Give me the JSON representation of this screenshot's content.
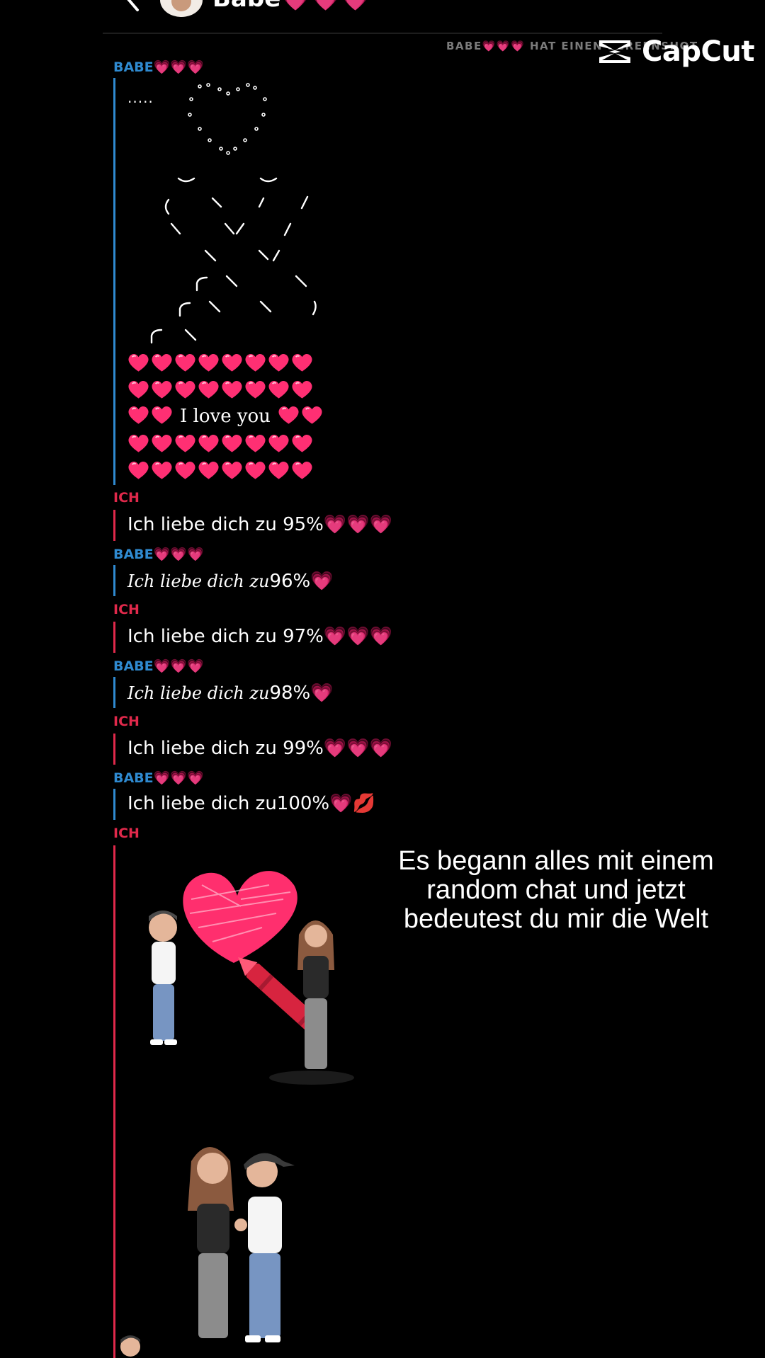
{
  "header": {
    "contact_name": "Babe",
    "contact_hearts": "💗💗💗"
  },
  "system_note": "BABE💗💗💗 HAT EINEN SCREENSHOT",
  "watermark": {
    "brand": "CapCut",
    "icon": "capcut-logo-icon"
  },
  "messages": [
    {
      "sender": "BABE💗💗💗",
      "type": "ascii-art",
      "prefix": ".....",
      "text": "I love you"
    },
    {
      "sender": "ICH",
      "text": "Ich liebe dich zu 95%💗💗💗"
    },
    {
      "sender": "BABE💗💗💗",
      "script": "Ich liebe dich zu",
      "text": "96%💗"
    },
    {
      "sender": "ICH",
      "text": "Ich liebe dich zu 97%💗💗💗"
    },
    {
      "sender": "BABE💗💗💗",
      "script": "Ich liebe dich zu",
      "text": "98%💗"
    },
    {
      "sender": "ICH",
      "text": "Ich liebe dich zu 99%💗💗💗"
    },
    {
      "sender": "BABE💗💗💗",
      "text": "Ich liebe dich zu100%💗💋"
    },
    {
      "sender": "ICH",
      "type": "stickers"
    }
  ],
  "overlay_caption": {
    "line1": "Es begann alles mit einem",
    "line2": "random chat und jetzt",
    "line3": "bedeutest du mir die Welt"
  },
  "colors": {
    "babe": "#2f8ad0",
    "ich": "#e0294b",
    "heart": "#ff2f73",
    "background": "#000000"
  }
}
